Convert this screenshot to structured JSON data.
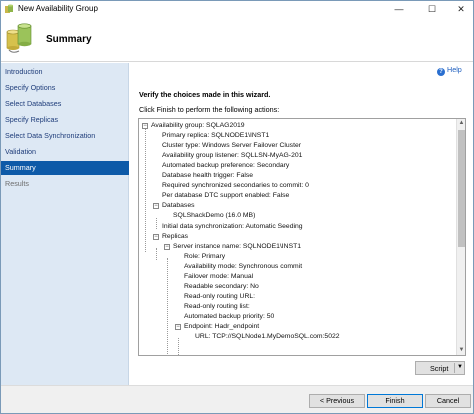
{
  "window": {
    "title": "New Availability Group",
    "minimize": "—",
    "maximize": "☐",
    "close": "✕"
  },
  "header": {
    "title": "Summary"
  },
  "nav": {
    "items": [
      {
        "label": "Introduction",
        "state": "link"
      },
      {
        "label": "Specify Options",
        "state": "link"
      },
      {
        "label": "Select Databases",
        "state": "link"
      },
      {
        "label": "Specify Replicas",
        "state": "link"
      },
      {
        "label": "Select Data Synchronization",
        "state": "link"
      },
      {
        "label": "Validation",
        "state": "link"
      },
      {
        "label": "Summary",
        "state": "active"
      },
      {
        "label": "Results",
        "state": "disabled"
      }
    ]
  },
  "help": {
    "label": "Help"
  },
  "main": {
    "verify_text": "Verify the choices made in this wizard.",
    "instruction": "Click Finish to perform the following actions:"
  },
  "tree": {
    "rows": [
      {
        "text": "Availability group: SQLAG2019",
        "toggle": "−"
      },
      {
        "text": "Primary replica: SQLNODE1\\INST1",
        "toggle": ""
      },
      {
        "text": "Cluster type: Windows Server Failover Cluster",
        "toggle": ""
      },
      {
        "text": "Availability group listener: SQLLSN-MyAG-201",
        "toggle": ""
      },
      {
        "text": "Automated backup preference: Secondary",
        "toggle": ""
      },
      {
        "text": "Database health trigger: False",
        "toggle": ""
      },
      {
        "text": "Required synchronized secondaries to commit: 0",
        "toggle": ""
      },
      {
        "text": "Per database DTC support enabled: False",
        "toggle": ""
      },
      {
        "text": "Databases",
        "toggle": "−"
      },
      {
        "text": "SQLShackDemo (16.0 MB)",
        "toggle": ""
      },
      {
        "text": "Initial data synchronization: Automatic Seeding",
        "toggle": ""
      },
      {
        "text": "Replicas",
        "toggle": "−"
      },
      {
        "text": "Server instance name: SQLNODE1\\INST1",
        "toggle": "−"
      },
      {
        "text": "Role: Primary",
        "toggle": ""
      },
      {
        "text": "Availability mode: Synchronous commit",
        "toggle": ""
      },
      {
        "text": "Failover mode: Manual",
        "toggle": ""
      },
      {
        "text": "Readable secondary: No",
        "toggle": ""
      },
      {
        "text": "Read-only routing URL:",
        "toggle": ""
      },
      {
        "text": "Read-only routing list:",
        "toggle": ""
      },
      {
        "text": "Automated backup priority: 50",
        "toggle": ""
      },
      {
        "text": "Endpoint: Hadr_endpoint",
        "toggle": "−"
      },
      {
        "text": "URL: TCP://SQLNode1.MyDemoSQL.com:5022",
        "toggle": ""
      }
    ]
  },
  "buttons": {
    "script": "Script",
    "previous": "< Previous",
    "finish": "Finish",
    "cancel": "Cancel"
  }
}
